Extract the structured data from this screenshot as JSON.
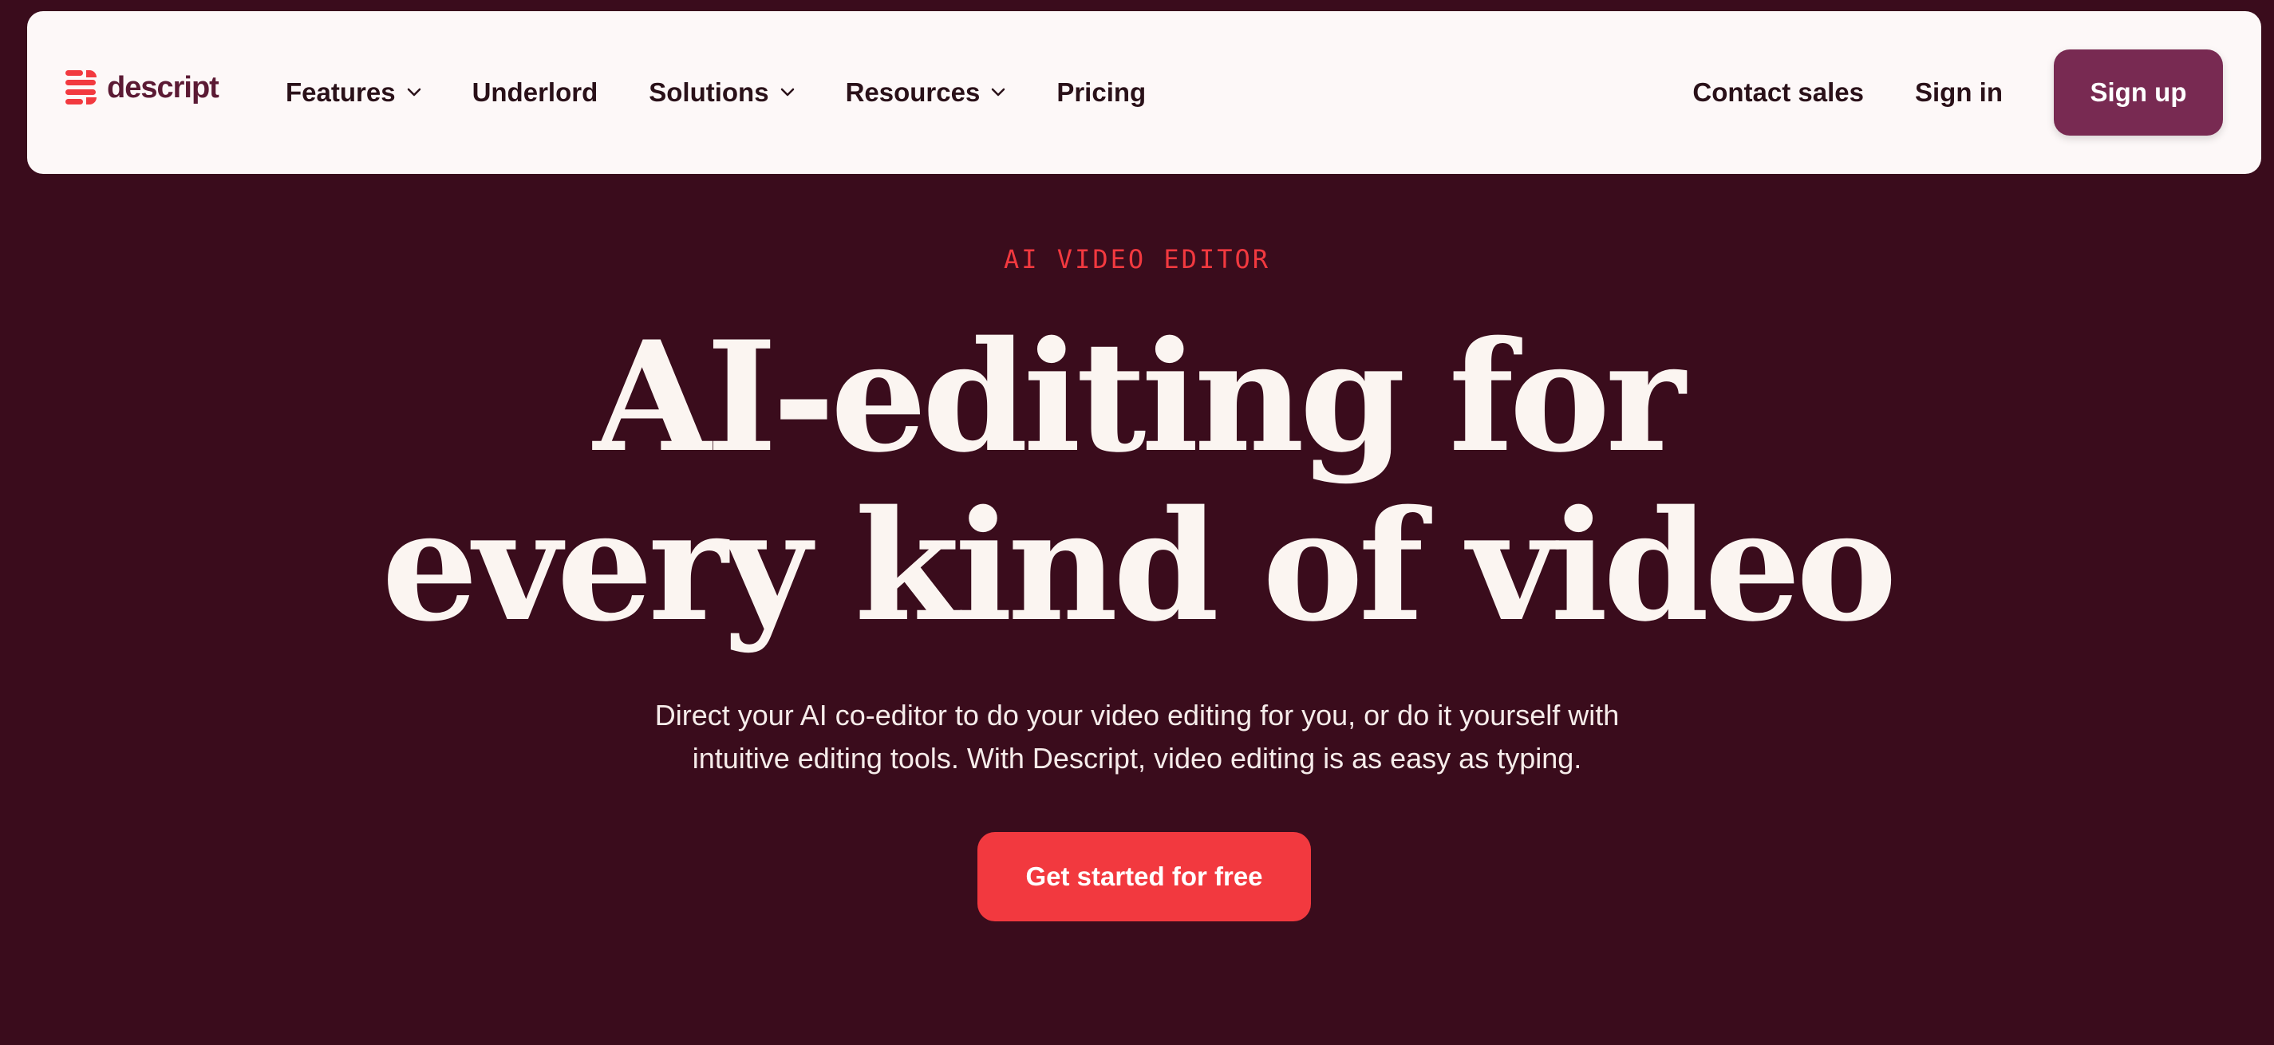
{
  "brand": {
    "name": "descript",
    "logo_icon": "descript-logo-icon",
    "accent_color": "#f2393f",
    "brand_color": "#782a52",
    "background_color": "#3a0c1c"
  },
  "nav": {
    "items": [
      {
        "label": "Features",
        "has_dropdown": true,
        "icon": "chevron-down-icon"
      },
      {
        "label": "Underlord",
        "has_dropdown": false
      },
      {
        "label": "Solutions",
        "has_dropdown": true,
        "icon": "chevron-down-icon"
      },
      {
        "label": "Resources",
        "has_dropdown": true,
        "icon": "chevron-down-icon"
      },
      {
        "label": "Pricing",
        "has_dropdown": false
      }
    ],
    "contact_sales": "Contact sales",
    "sign_in": "Sign in",
    "sign_up": "Sign up"
  },
  "hero": {
    "eyebrow": "AI VIDEO EDITOR",
    "headline_line1": "AI-editing for",
    "headline_line2": "every kind of video",
    "subhead_line1": "Direct your AI co-editor to do your video editing for you, or do it yourself with",
    "subhead_line2": "intuitive editing tools. With Descript, video editing is as easy as typing.",
    "cta": "Get started for free"
  }
}
